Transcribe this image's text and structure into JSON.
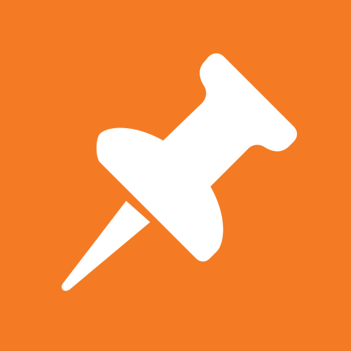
{
  "icon": {
    "name": "pushpin-icon"
  },
  "colors": {
    "background": "#f47b24",
    "glyph": "#ffffff"
  }
}
